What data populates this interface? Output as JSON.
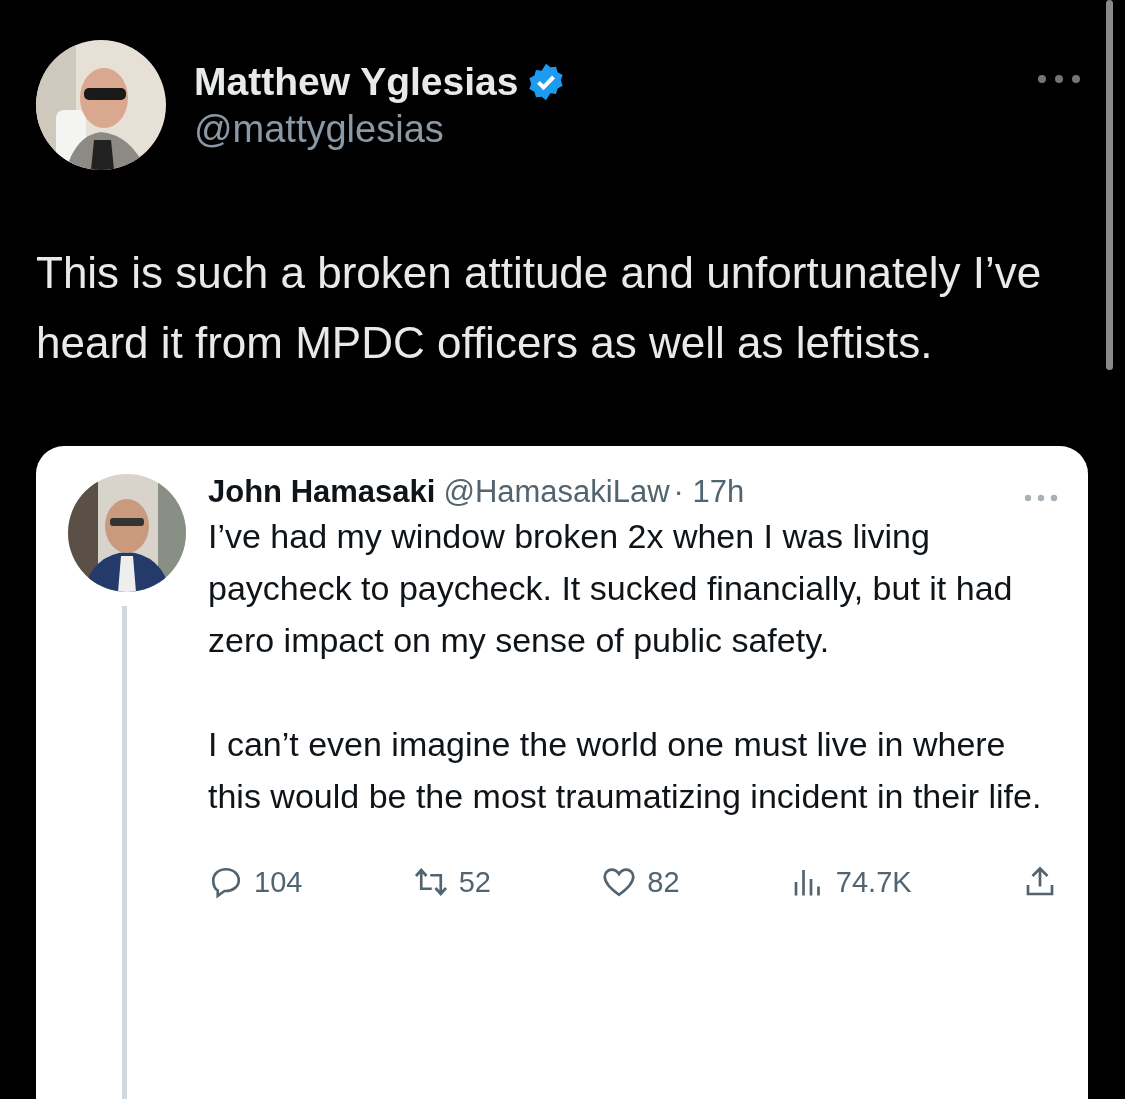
{
  "tweet": {
    "author": {
      "name": "Matthew Yglesias",
      "handle": "@mattyglesias",
      "verified": true
    },
    "text": "This is such a broken attitude and unfortunately I’ve heard it from MPDC officers as well as leftists."
  },
  "quoted_tweet": {
    "author": {
      "name": "John Hamasaki",
      "handle": "@HamasakiLaw",
      "time": "· 17h"
    },
    "paragraphs": [
      "I’ve had my window broken 2x when I was living paycheck to paycheck. It sucked financially, but it had zero impact on my sense of public safety.",
      "I can’t even imagine the world one must live in where this would be the most traumatizing incident in their life."
    ],
    "actions": [
      {
        "kind": "reply",
        "count": "104"
      },
      {
        "kind": "retweet",
        "count": "52"
      },
      {
        "kind": "like",
        "count": "82"
      },
      {
        "kind": "views",
        "count": "74.7K"
      },
      {
        "kind": "share"
      }
    ]
  }
}
